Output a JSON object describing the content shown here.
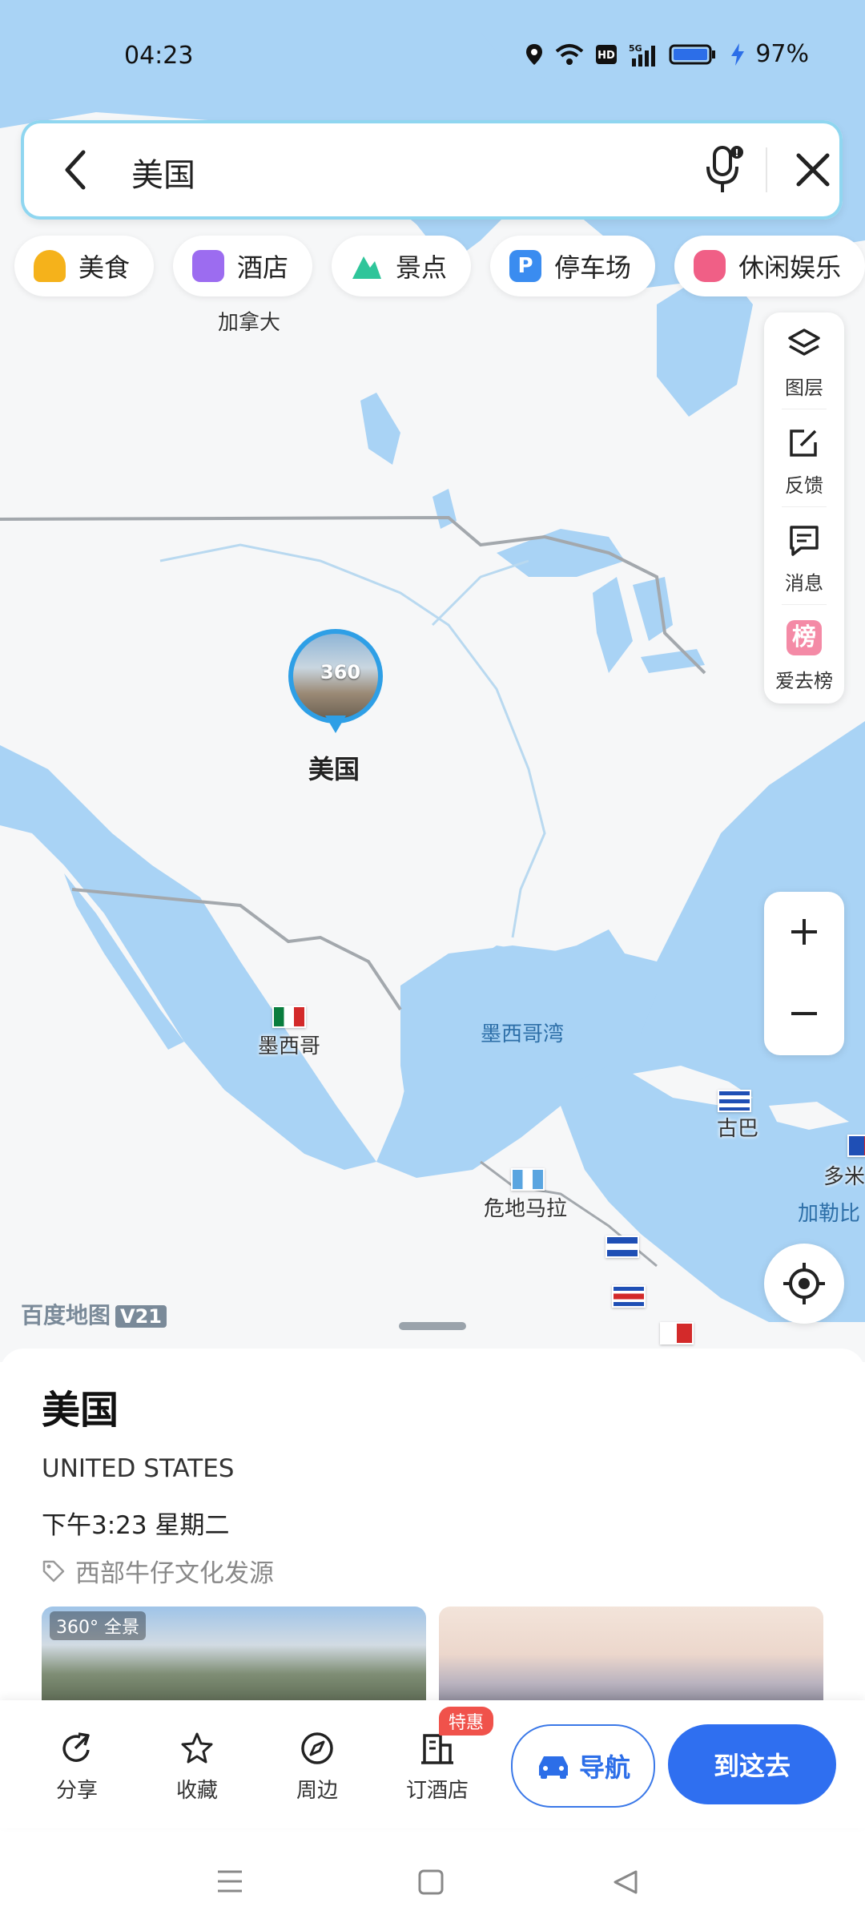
{
  "status": {
    "time": "04:23",
    "battery": "97%"
  },
  "search": {
    "query": "美国"
  },
  "chips": [
    {
      "label": "美食",
      "icon": "food-icon",
      "color": "#f5b21b"
    },
    {
      "label": "酒店",
      "icon": "hotel-icon",
      "color": "#9c6cf0"
    },
    {
      "label": "景点",
      "icon": "scenic-icon",
      "color": "#2fc59a"
    },
    {
      "label": "停车场",
      "icon": "parking-icon",
      "color": "#3a8cf0"
    },
    {
      "label": "休闲娱乐",
      "icon": "game-icon",
      "color": "#f05f86"
    }
  ],
  "tools": {
    "layers": "图层",
    "feedback": "反馈",
    "messages": "消息",
    "ranking": "爱去榜",
    "ranking_glyph": "榜"
  },
  "map": {
    "canada": "加拿大",
    "usa_pin": "美国",
    "pin_360": "360",
    "mexico": "墨西哥",
    "gulf": "墨西哥湾",
    "cuba": "古巴",
    "guatemala": "危地马拉",
    "dominican": "多米",
    "caribbean": "加勒比",
    "watermark": "百度地图",
    "watermark_version": "V21"
  },
  "place": {
    "name": "美国",
    "english": "UNITED STATES",
    "local_time": "下午3:23 星期二",
    "tag": "西部牛仔文化发源",
    "photo_badge": "360° 全景"
  },
  "actions": {
    "share": "分享",
    "favorite": "收藏",
    "nearby": "周边",
    "hotel": "订酒店",
    "hotel_badge": "特惠",
    "navigate": "导航",
    "go": "到这去"
  },
  "colors": {
    "accent": "#2f6ff0",
    "water": "#a9d3f5",
    "land": "#f7f8f9"
  }
}
